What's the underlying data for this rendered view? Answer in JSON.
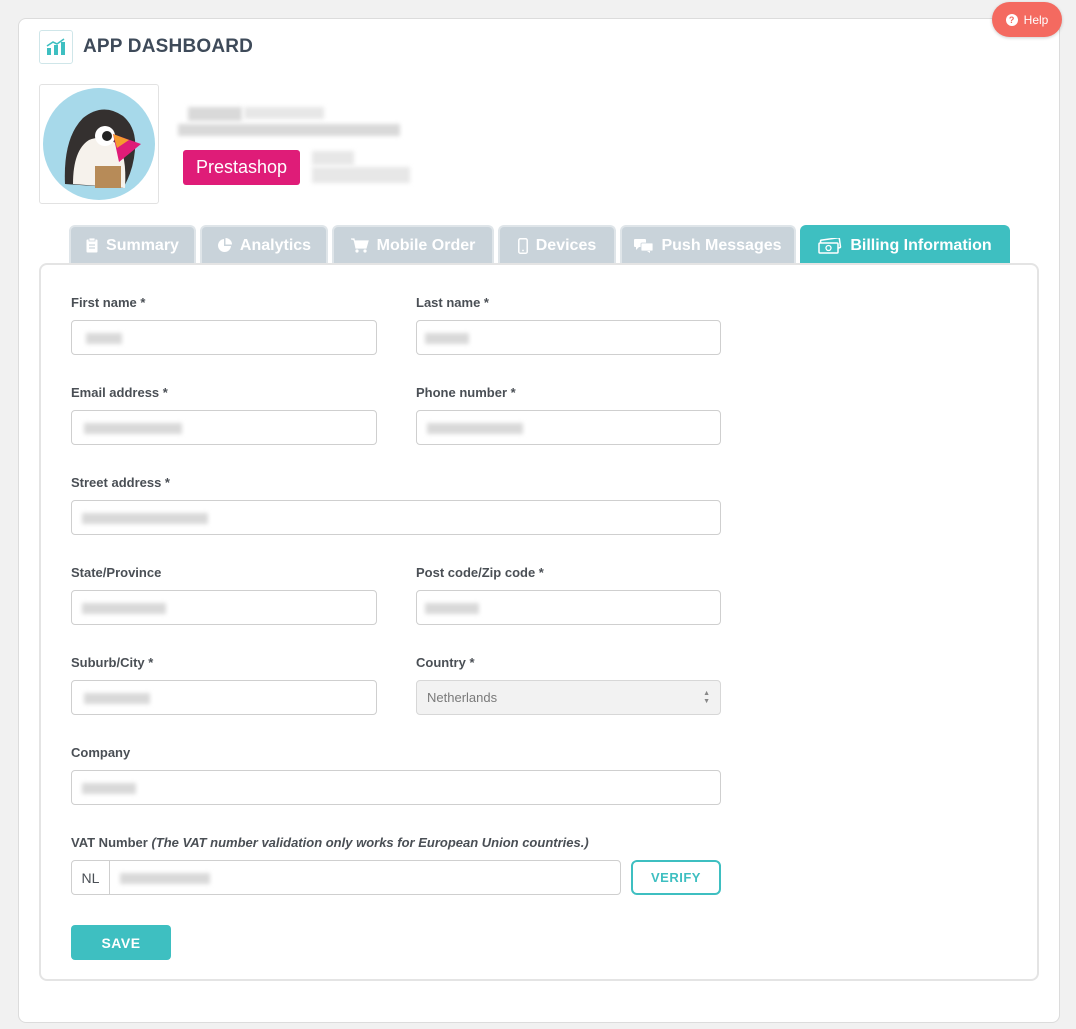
{
  "help_label": "Help",
  "header": {
    "title": "APP DASHBOARD"
  },
  "app": {
    "platform_badge": "Prestashop"
  },
  "tabs": [
    {
      "label": "Summary",
      "icon": "clipboard-icon"
    },
    {
      "label": "Analytics",
      "icon": "pie-chart-icon"
    },
    {
      "label": "Mobile Order",
      "icon": "cart-icon"
    },
    {
      "label": "Devices",
      "icon": "phone-icon"
    },
    {
      "label": "Push Messages",
      "icon": "chat-icon"
    },
    {
      "label": "Billing Information",
      "icon": "money-icon",
      "active": true
    }
  ],
  "form": {
    "first_name_label": "First name *",
    "last_name_label": "Last name *",
    "email_label": "Email address *",
    "phone_label": "Phone number *",
    "street_label": "Street address *",
    "state_label": "State/Province",
    "postcode_label": "Post code/Zip code *",
    "city_label": "Suburb/City *",
    "country_label": "Country *",
    "country_value": "Netherlands",
    "company_label": "Company",
    "vat_label": "VAT Number",
    "vat_hint": "(The VAT number validation only works for European Union countries.)",
    "vat_prefix": "NL",
    "verify_label": "VERIFY",
    "save_label": "SAVE"
  },
  "colors": {
    "accent": "#3ebfc1",
    "help": "#f46a60",
    "badge": "#df1c78",
    "tab_inactive": "#c9d3da"
  }
}
